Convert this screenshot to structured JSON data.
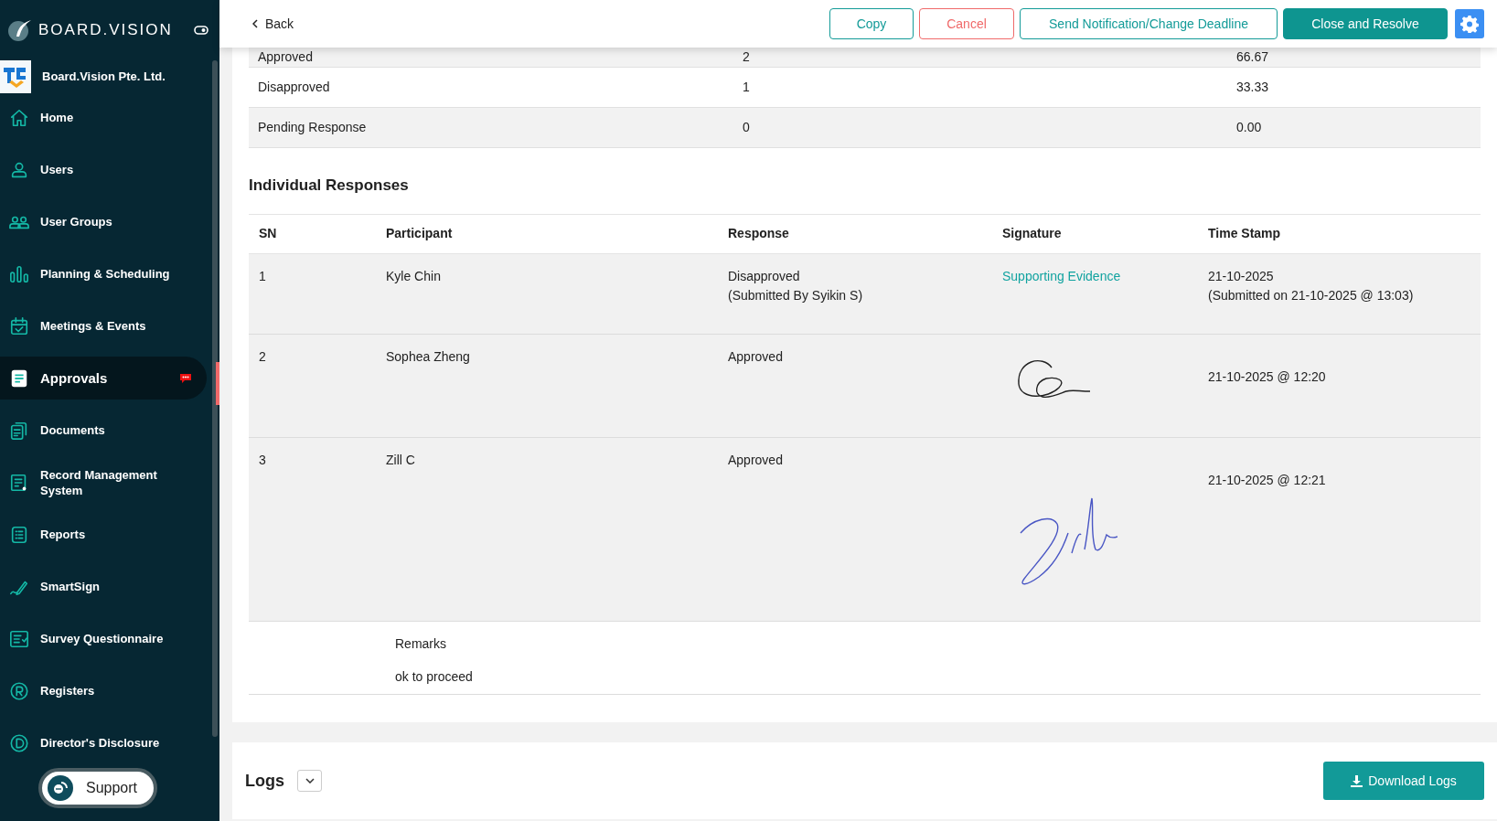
{
  "brand": {
    "name": "BOARD.VISION"
  },
  "organization": {
    "name": "Board.Vision Pte. Ltd."
  },
  "sidebar": {
    "items": [
      {
        "label": "Home",
        "selected": false,
        "badge": false
      },
      {
        "label": "Users",
        "selected": false,
        "badge": false
      },
      {
        "label": "User Groups",
        "selected": false,
        "badge": false
      },
      {
        "label": "Planning & Scheduling",
        "selected": false,
        "badge": false
      },
      {
        "label": "Meetings & Events",
        "selected": false,
        "badge": false
      },
      {
        "label": "Approvals",
        "selected": true,
        "badge": true
      },
      {
        "label": "Documents",
        "selected": false,
        "badge": false
      },
      {
        "label": "Record Management System",
        "selected": false,
        "badge": false
      },
      {
        "label": "Reports",
        "selected": false,
        "badge": false
      },
      {
        "label": "SmartSign",
        "selected": false,
        "badge": false
      },
      {
        "label": "Survey Questionnaire",
        "selected": false,
        "badge": false
      },
      {
        "label": "Registers",
        "selected": false,
        "badge": false
      },
      {
        "label": "Director's Disclosure",
        "selected": false,
        "badge": false
      }
    ],
    "support": "Support"
  },
  "toolbar": {
    "back": "Back",
    "buttons": [
      {
        "label": "Copy",
        "kind": "outline"
      },
      {
        "label": "Cancel",
        "kind": "danger"
      },
      {
        "label": "Send Notification/Change Deadline",
        "kind": "outline"
      },
      {
        "label": "Close and Resolve",
        "kind": "primary"
      }
    ]
  },
  "summary": {
    "rows": [
      {
        "label": "Approved",
        "count": "2",
        "percent": "66.67"
      },
      {
        "label": "Disapproved",
        "count": "1",
        "percent": "33.33"
      },
      {
        "label": "Pending Response",
        "count": "0",
        "percent": "0.00"
      }
    ]
  },
  "individual": {
    "title": "Individual Responses",
    "columns": [
      "SN",
      "Participant",
      "Response",
      "Signature",
      "Time Stamp"
    ],
    "rows": [
      {
        "sn": "1",
        "participant": "Kyle Chin",
        "response": [
          "Disapproved",
          "(Submitted By Syikin S)"
        ],
        "signature": {
          "kind": "link",
          "text": "Supporting Evidence"
        },
        "timestamp": [
          "21-10-2025",
          "(Submitted on 21-10-2025 @ 13:03)"
        ]
      },
      {
        "sn": "2",
        "participant": "Sophea Zheng",
        "response": [
          "Approved"
        ],
        "signature": {
          "kind": "loop"
        },
        "timestamp": [
          "21-10-2025 @ 12:20"
        ]
      },
      {
        "sn": "3",
        "participant": "Zill C",
        "response": [
          "Approved"
        ],
        "signature": {
          "kind": "script"
        },
        "timestamp": [
          "21-10-2025 @ 12:21"
        ]
      }
    ],
    "remarks_label": "Remarks",
    "remarks": "ok to proceed"
  },
  "logs": {
    "title": "Logs",
    "download": "Download Logs"
  }
}
